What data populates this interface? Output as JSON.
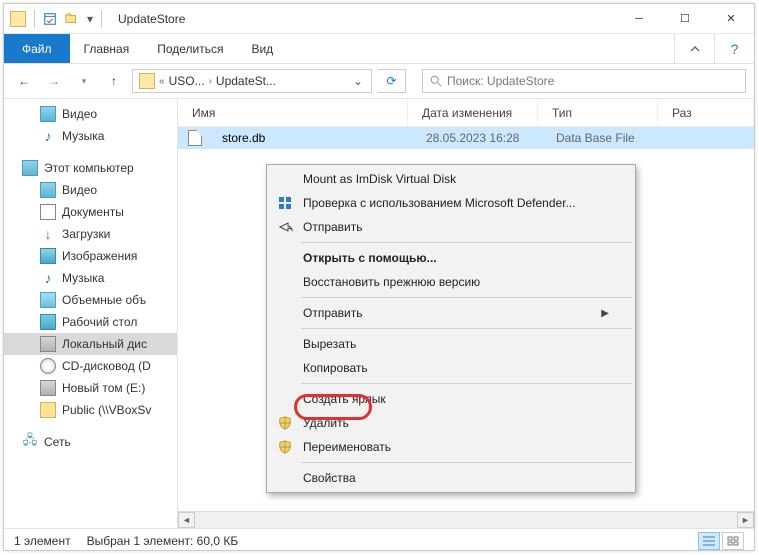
{
  "titlebar": {
    "title": "UpdateStore"
  },
  "ribbon": {
    "file": "Файл",
    "home": "Главная",
    "share": "Поделиться",
    "view": "Вид"
  },
  "breadcrumb": {
    "seg1": "USO...",
    "seg2": "UpdateSt..."
  },
  "search": {
    "placeholder": "Поиск: UpdateStore"
  },
  "tree": {
    "video": "Видео",
    "music": "Музыка",
    "thispc": "Этот компьютер",
    "video2": "Видео",
    "documents": "Документы",
    "downloads": "Загрузки",
    "images": "Изображения",
    "music2": "Музыка",
    "objects3d": "Объемные объ",
    "desktop": "Рабочий стол",
    "localdisk": "Локальный дис",
    "cd": "CD-дисковод (D",
    "newvol": "Новый том (E:)",
    "public": "Public (\\\\VBoxSv",
    "network": "Сеть"
  },
  "columns": {
    "name": "Имя",
    "date": "Дата изменения",
    "type": "Тип",
    "size": "Раз"
  },
  "file": {
    "name": "store.db",
    "date": "28.05.2023 16:28",
    "type": "Data Base File"
  },
  "context": {
    "mount": "Mount as ImDisk Virtual Disk",
    "defender": "Проверка с использованием Microsoft Defender...",
    "share": "Отправить",
    "openwith": "Открыть с помощью...",
    "restore": "Восстановить прежнюю версию",
    "sendto": "Отправить",
    "cut": "Вырезать",
    "copy": "Копировать",
    "shortcut": "Создать ярлык",
    "delete": "Удалить",
    "rename": "Переименовать",
    "properties": "Свойства"
  },
  "status": {
    "count": "1 элемент",
    "selected": "Выбран 1 элемент: 60,0 КБ"
  }
}
